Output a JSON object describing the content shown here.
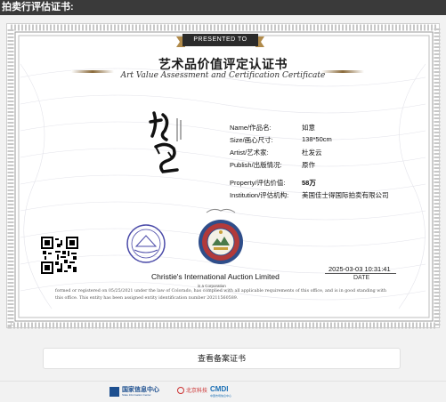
{
  "page": {
    "heading": "拍卖行评估证书:"
  },
  "certificate": {
    "ribbon_label": "PRESENTED TO",
    "title_cn": "艺术品价值评定认证书",
    "title_en": "Art Value Assessment and Certification Certificate",
    "fields": {
      "name_label": "Name/作品名:",
      "name_value": "如意",
      "size_label": "Size/画心尺寸:",
      "size_value": "138*50cm",
      "artist_label": "Artist/艺术家:",
      "artist_value": "杜发云",
      "publish_label": "Publish/出版情况:",
      "publish_value": "原作",
      "property_label": "Property/评估价值:",
      "property_value": "58万",
      "institution_label": "Institution/评估机构:",
      "institution_value": "美国佳士得国际拍卖有限公司"
    },
    "company_name": "Christie's International Auction Limited",
    "corporation_note": "is a Corporation",
    "fineprint": "formed or registered on 05/25/2021 under the law of Colorado, has complied with all applicable requirements of this office, and is in good standing with this office. This entity has been assigned entity identification number 20211560589.",
    "date_value": "2025-03-03  10:31:41",
    "date_label": "DATE"
  },
  "actions": {
    "view_record_label": "查看备案证书"
  },
  "footer": {
    "logo1_text": "国家信息中心",
    "logo1_sub": "State Information Center",
    "logo2_text": "北京科技",
    "logo3_text": "CMDI",
    "logo3_sub": "中国市场信息中心"
  },
  "colors": {
    "topbar": "#3a3a3a",
    "ribbon": "#2b2b2b",
    "accent_gold": "#b08a4a",
    "link_blue": "#1d4f8f"
  },
  "icons": [
    "qr-code-icon",
    "seal-icon",
    "colorado-seal-icon",
    "state-info-center-logo",
    "cmdi-logo"
  ]
}
